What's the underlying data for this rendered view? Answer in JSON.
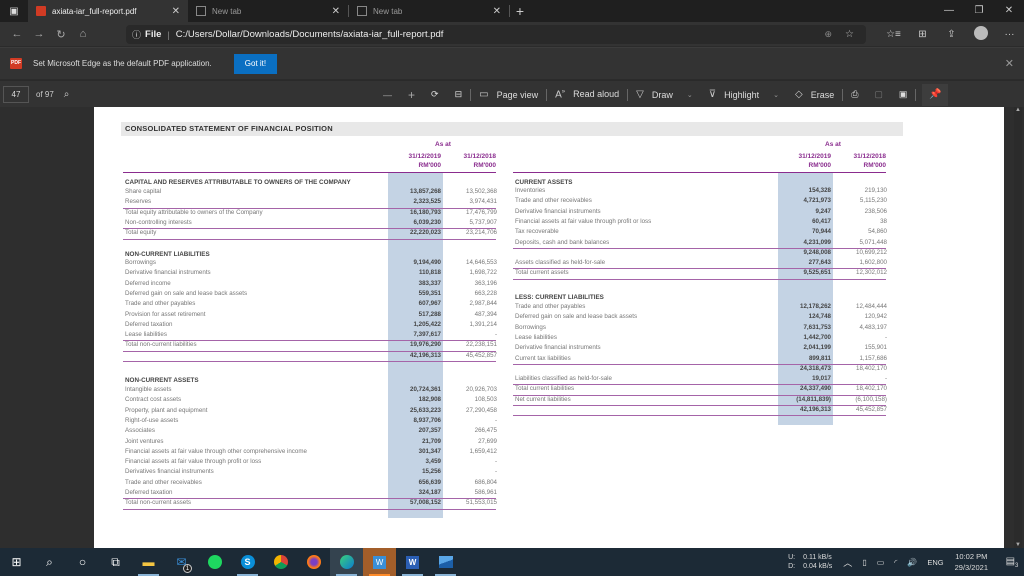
{
  "browser": {
    "tabs": [
      {
        "title": "axiata-iar_full-report.pdf",
        "active": true
      },
      {
        "title": "New tab",
        "active": false
      },
      {
        "title": "New tab",
        "active": false
      }
    ],
    "address": {
      "scheme_label": "File",
      "url": "C:/Users/Dollar/Downloads/Documents/axiata-iar_full-report.pdf"
    },
    "infobar": {
      "message": "Set Microsoft Edge as the default PDF application.",
      "button": "Got it!"
    }
  },
  "pdf_toolbar": {
    "page_number": "47",
    "page_count": "of 97",
    "page_view": "Page view",
    "read_aloud": "Read aloud",
    "draw": "Draw",
    "highlight": "Highlight",
    "erase": "Erase"
  },
  "document": {
    "title": "CONSOLIDATED STATEMENT OF FINANCIAL POSITION",
    "as_at": "As at",
    "col1": {
      "date": "31/12/2019",
      "unit": "RM'000"
    },
    "col2": {
      "date": "31/12/2018",
      "unit": "RM'000"
    },
    "left": {
      "equity_heading": "CAPITAL AND RESERVES ATTRIBUTABLE TO OWNERS OF THE COMPANY",
      "equity_rows": [
        {
          "label": "Share capital",
          "v2019": "13,857,268",
          "v2018": "13,502,368"
        },
        {
          "label": "Reserves",
          "v2019": "2,323,525",
          "v2018": "3,974,431"
        },
        {
          "label": "Total equity attributable to owners of the Company",
          "v2019": "16,180,793",
          "v2018": "17,476,799"
        },
        {
          "label": "Non-controlling interests",
          "v2019": "6,039,230",
          "v2018": "5,737,907"
        },
        {
          "label": "Total equity",
          "v2019": "22,220,023",
          "v2018": "23,214,706"
        }
      ],
      "ncl_heading": "NON-CURRENT LIABILITIES",
      "ncl_rows": [
        {
          "label": "Borrowings",
          "v2019": "9,194,490",
          "v2018": "14,646,553"
        },
        {
          "label": "Derivative financial instruments",
          "v2019": "110,818",
          "v2018": "1,698,722"
        },
        {
          "label": "Deferred income",
          "v2019": "383,337",
          "v2018": "363,196"
        },
        {
          "label": "Deferred gain on sale and lease back assets",
          "v2019": "559,351",
          "v2018": "663,228"
        },
        {
          "label": "Trade and other payables",
          "v2019": "607,967",
          "v2018": "2,987,844"
        },
        {
          "label": "Provision for asset retirement",
          "v2019": "517,288",
          "v2018": "487,394"
        },
        {
          "label": "Deferred taxation",
          "v2019": "1,205,422",
          "v2018": "1,391,214"
        },
        {
          "label": "Lease liabilities",
          "v2019": "7,397,617",
          "v2018": "-"
        },
        {
          "label": "Total non-current liabilities",
          "v2019": "19,976,290",
          "v2018": "22,238,151"
        },
        {
          "label": "",
          "v2019": "42,196,313",
          "v2018": "45,452,857"
        }
      ],
      "nca_heading": "NON-CURRENT ASSETS",
      "nca_rows": [
        {
          "label": "Intangible assets",
          "v2019": "20,724,361",
          "v2018": "20,926,703"
        },
        {
          "label": "Contract cost assets",
          "v2019": "182,908",
          "v2018": "108,503"
        },
        {
          "label": "Property, plant and equipment",
          "v2019": "25,633,223",
          "v2018": "27,290,458"
        },
        {
          "label": "Right-of-use assets",
          "v2019": "8,937,706",
          "v2018": "-"
        },
        {
          "label": "Associates",
          "v2019": "207,357",
          "v2018": "266,475"
        },
        {
          "label": "Joint ventures",
          "v2019": "21,709",
          "v2018": "27,699"
        },
        {
          "label": "Financial assets at fair value through other comprehensive income",
          "v2019": "301,347",
          "v2018": "1,659,412"
        },
        {
          "label": "Financial assets at fair value through profit or loss",
          "v2019": "3,459",
          "v2018": "-"
        },
        {
          "label": "Derivatives financial instruments",
          "v2019": "15,256",
          "v2018": "-"
        },
        {
          "label": "Trade and other receivables",
          "v2019": "656,639",
          "v2018": "686,804"
        },
        {
          "label": "Deferred taxation",
          "v2019": "324,187",
          "v2018": "586,961"
        },
        {
          "label": "Total non-current assets",
          "v2019": "57,008,152",
          "v2018": "51,553,015"
        }
      ]
    },
    "right": {
      "ca_heading": "CURRENT ASSETS",
      "ca_rows": [
        {
          "label": "Inventories",
          "v2019": "154,328",
          "v2018": "219,130"
        },
        {
          "label": "Trade and other receivables",
          "v2019": "4,721,973",
          "v2018": "5,115,230"
        },
        {
          "label": "Derivative financial instruments",
          "v2019": "9,247",
          "v2018": "238,506"
        },
        {
          "label": "Financial assets at fair value through profit or loss",
          "v2019": "60,417",
          "v2018": "38"
        },
        {
          "label": "Tax recoverable",
          "v2019": "70,944",
          "v2018": "54,860"
        },
        {
          "label": "Deposits, cash and bank balances",
          "v2019": "4,231,099",
          "v2018": "5,071,448"
        },
        {
          "label": "",
          "v2019": "9,248,008",
          "v2018": "10,699,212"
        },
        {
          "label": "Assets classified as held-for-sale",
          "v2019": "277,643",
          "v2018": "1,602,800"
        },
        {
          "label": "Total current assets",
          "v2019": "9,525,651",
          "v2018": "12,302,012"
        }
      ],
      "cl_heading": "LESS: CURRENT LIABILITIES",
      "cl_rows": [
        {
          "label": "Trade and other payables",
          "v2019": "12,178,262",
          "v2018": "12,484,444"
        },
        {
          "label": "Deferred gain on sale and lease back assets",
          "v2019": "124,748",
          "v2018": "120,942"
        },
        {
          "label": "Borrowings",
          "v2019": "7,631,753",
          "v2018": "4,483,197"
        },
        {
          "label": "Lease liabilities",
          "v2019": "1,442,700",
          "v2018": "-"
        },
        {
          "label": "Derivative financial instruments",
          "v2019": "2,041,199",
          "v2018": "155,901"
        },
        {
          "label": "Current tax liabilities",
          "v2019": "899,811",
          "v2018": "1,157,686"
        },
        {
          "label": "",
          "v2019": "24,318,473",
          "v2018": "18,402,170"
        },
        {
          "label": "Liabilities classified as held-for-sale",
          "v2019": "19,017",
          "v2018": "-"
        },
        {
          "label": "Total current liabilities",
          "v2019": "24,337,490",
          "v2018": "18,402,170"
        },
        {
          "label": "Net current liabilities",
          "v2019": "(14,811,839)",
          "v2018": "(6,100,158)"
        },
        {
          "label": "",
          "v2019": "42,196,313",
          "v2018": "45,452,857"
        }
      ]
    }
  },
  "taskbar": {
    "mail_badge": "1",
    "net_up_label": "U:",
    "net_down_label": "D:",
    "net_up": "0.11 kB/s",
    "net_down": "0.04 kB/s",
    "language": "ENG",
    "time": "10:02 PM",
    "date": "29/3/2021",
    "notification_count": "3"
  }
}
